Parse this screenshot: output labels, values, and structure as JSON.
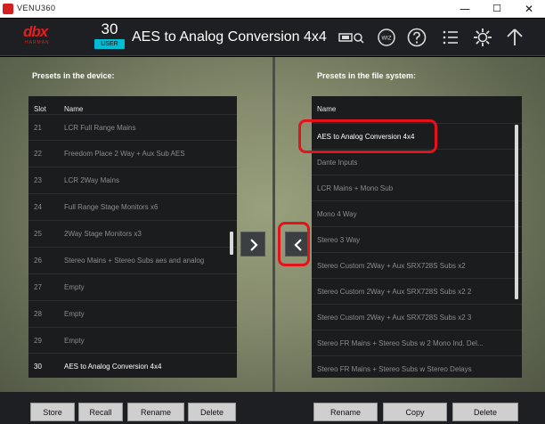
{
  "window": {
    "title": "VENU360",
    "minimize": "—",
    "maximize": "☐",
    "close": "✕"
  },
  "header": {
    "logo_text": "dbx",
    "logo_sub": "HARMAN",
    "preset_number": "30",
    "user_badge": "USER",
    "preset_name": "AES to Analog Conversion 4x4",
    "icons": [
      "network-icon",
      "wizard-icon",
      "help-icon",
      "list-icon",
      "settings-icon",
      "home-icon"
    ]
  },
  "device_panel": {
    "title": "Presets in the device:",
    "col_slot": "Slot",
    "col_name": "Name",
    "rows": [
      {
        "slot": "21",
        "name": "LCR Full Range Mains"
      },
      {
        "slot": "22",
        "name": "Freedom Place 2 Way  + Aux Sub AES"
      },
      {
        "slot": "23",
        "name": "LCR 2Way Mains"
      },
      {
        "slot": "24",
        "name": "Full Range Stage Monitors x6"
      },
      {
        "slot": "25",
        "name": "2Way Stage Monitors x3"
      },
      {
        "slot": "26",
        "name": "Stereo Mains + Stereo Subs aes and analog"
      },
      {
        "slot": "27",
        "name": "Empty"
      },
      {
        "slot": "28",
        "name": "Empty"
      },
      {
        "slot": "29",
        "name": "Empty"
      },
      {
        "slot": "30",
        "name": "AES to Analog Conversion 4x4"
      }
    ],
    "buttons": {
      "store": "Store",
      "recall": "Recall",
      "rename": "Rename",
      "delete": "Delete"
    }
  },
  "file_panel": {
    "title": "Presets in the file system:",
    "col_name": "Name",
    "rows": [
      "AES to Analog Conversion 4x4",
      "Dante Inputs",
      "LCR Mains + Mono Sub",
      "Mono 4 Way",
      "Stereo 3 Way",
      "Stereo Custom 2Way + Aux SRX728S Subs x2",
      "Stereo Custom 2Way + Aux SRX728S Subs x2 2",
      "Stereo Custom 2Way + Aux SRX728S Subs x2 3",
      "Stereo FR Mains + Stereo Subs w 2 Mono Ind. Del...",
      "Stereo FR Mains + Stereo Subs w Stereo Delays"
    ],
    "buttons": {
      "rename": "Rename",
      "copy": "Copy",
      "delete": "Delete"
    }
  },
  "colors": {
    "accent": "#00bcd4",
    "brand": "#e02020",
    "annotation": "#e3121b"
  }
}
